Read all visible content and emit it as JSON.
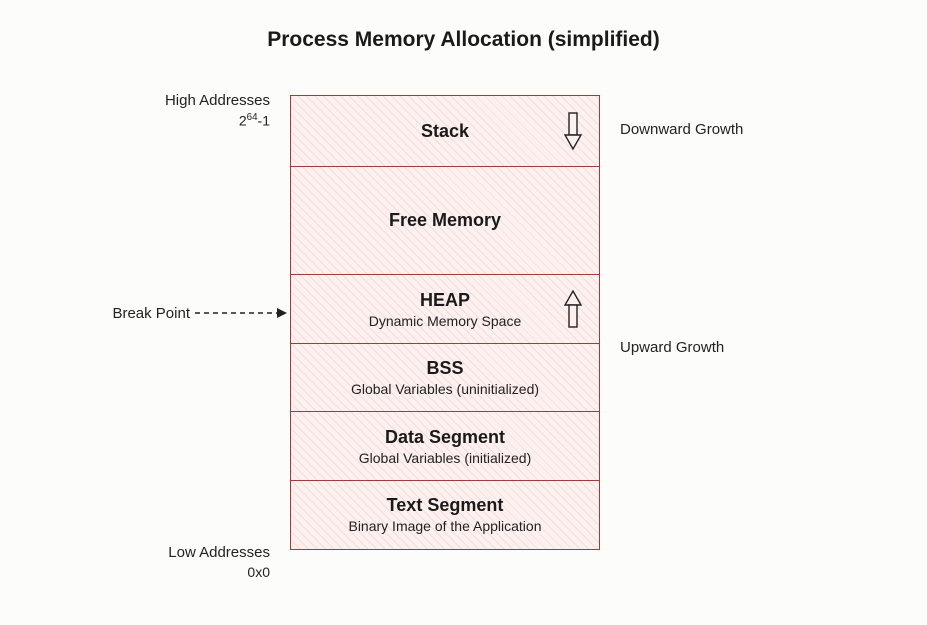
{
  "title": "Process Memory Allocation (simplified)",
  "leftLabels": {
    "high": {
      "line1": "High Addresses",
      "line2_pre": "2",
      "line2_exp": "64",
      "line2_post": "-1"
    },
    "break": "Break Point",
    "low": {
      "line1": "Low Addresses",
      "line2": "0x0"
    }
  },
  "rightLabels": {
    "down": "Downward Growth",
    "up": "Upward Growth"
  },
  "segments": {
    "stack": {
      "title": "Stack"
    },
    "free": {
      "title": "Free Memory"
    },
    "heap": {
      "title": "HEAP",
      "sub": "Dynamic Memory Space"
    },
    "bss": {
      "title": "BSS",
      "sub": "Global Variables (uninitialized)"
    },
    "data": {
      "title": "Data Segment",
      "sub": "Global Variables (initialized)"
    },
    "text": {
      "title": "Text Segment",
      "sub": "Binary Image of the Application"
    }
  }
}
